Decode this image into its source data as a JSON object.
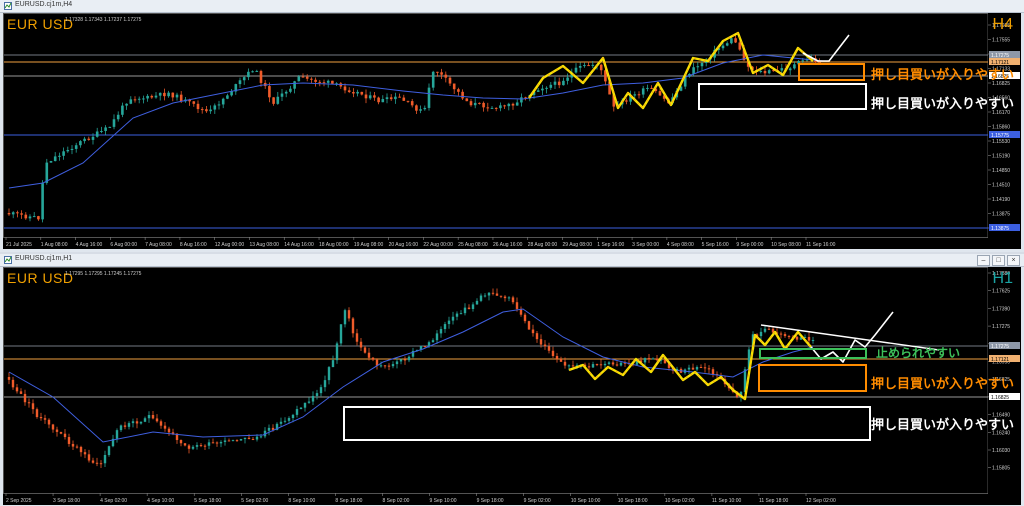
{
  "windows": [
    {
      "title": "EURUSD.cj1m,H4",
      "symbol_label": "EUR USD",
      "ohlc_text": "1.17328 1.17343 1.17237 1.17275",
      "timeframe": "H4",
      "timeframe_color": "#f0a000",
      "annotations": [
        {
          "text": "押し目買いが入りやすい",
          "color": "#ff8c00"
        },
        {
          "text": "押し目買いが入りやすい",
          "color": "#ffffff"
        }
      ],
      "chart_data": {
        "type": "candlestick",
        "x_tick_labels": [
          "21 Jul 2025",
          "1 Aug 08:00",
          "4 Aug 16:00",
          "6 Aug 00:00",
          "7 Aug 08:00",
          "8 Aug 16:00",
          "12 Aug 00:00",
          "13 Aug 08:00",
          "14 Aug 16:00",
          "18 Aug 00:00",
          "19 Aug 08:00",
          "20 Aug 16:00",
          "22 Aug 00:00",
          "25 Aug 08:00",
          "26 Aug 16:00",
          "28 Aug 00:00",
          "29 Aug 08:00",
          "1 Sep 16:00",
          "3 Sep 00:00",
          "4 Sep 08:00",
          "5 Sep 16:00",
          "9 Sep 00:00",
          "10 Sep 08:00",
          "11 Sep 16:00"
        ],
        "y_tick_labels": [
          "1.17935",
          "1.17555",
          "1.17275",
          "1.17133",
          "1.16825",
          "1.16560",
          "1.16170",
          "1.15860",
          "1.15530",
          "1.15190",
          "1.14850",
          "1.14510",
          "1.14190",
          "1.13875",
          "1.13840"
        ],
        "y_highlight_labels": [
          {
            "value": "1.17275",
            "bg": "#8e98a8"
          },
          {
            "value": "1.17121",
            "bg": "#f0b070"
          },
          {
            "value": "1.16825",
            "bg": "#ffffff"
          },
          {
            "value": "1.15775",
            "bg": "#3c5fe0"
          },
          {
            "value": "1.13875",
            "bg": "#3c5fe0"
          }
        ],
        "ylim": [
          1.137,
          1.182
        ],
        "up_color": "#26a69a",
        "down_color": "#ef5b2a",
        "ma_color": "#3f5fe0"
      }
    },
    {
      "title": "EURUSD.cj1m,H1",
      "symbol_label": "EUR USD",
      "ohlc_text": "1.17295 1.17295 1.17245 1.17275",
      "timeframe": "H1",
      "timeframe_color": "#1aa3a3",
      "annotations": [
        {
          "text": "止められやすい",
          "color": "#3cc05a"
        },
        {
          "text": "押し目買いが入りやすい",
          "color": "#ff8c00"
        },
        {
          "text": "押し目買いが入りやすい",
          "color": "#ffffff"
        }
      ],
      "chart_data": {
        "type": "candlestick",
        "x_tick_labels": [
          "2 Sep 2025",
          "3 Sep 18:00",
          "4 Sep 02:00",
          "4 Sep 10:00",
          "5 Sep 18:00",
          "5 Sep 02:00",
          "8 Sep 10:00",
          "8 Sep 18:00",
          "8 Sep 02:00",
          "9 Sep 10:00",
          "9 Sep 18:00",
          "9 Sep 02:00",
          "10 Sep 10:00",
          "10 Sep 18:00",
          "10 Sep 02:00",
          "11 Sep 10:00",
          "11 Sep 18:00",
          "12 Sep 02:00"
        ],
        "y_tick_labels": [
          "1.17880",
          "1.17625",
          "1.17390",
          "1.17275",
          "1.17121",
          "1.16950",
          "1.16825",
          "1.16705",
          "1.16490",
          "1.16240",
          "1.16030",
          "1.15805"
        ],
        "y_highlight_labels": [
          {
            "value": "1.17275",
            "bg": "#8e98a8"
          },
          {
            "value": "1.17121",
            "bg": "#f0b070"
          },
          {
            "value": "1.16825",
            "bg": "#ffffff"
          }
        ],
        "ylim": [
          1.157,
          1.182
        ],
        "up_color": "#26a69a",
        "down_color": "#ef5b2a",
        "ma_color": "#3f5fe0"
      }
    }
  ]
}
